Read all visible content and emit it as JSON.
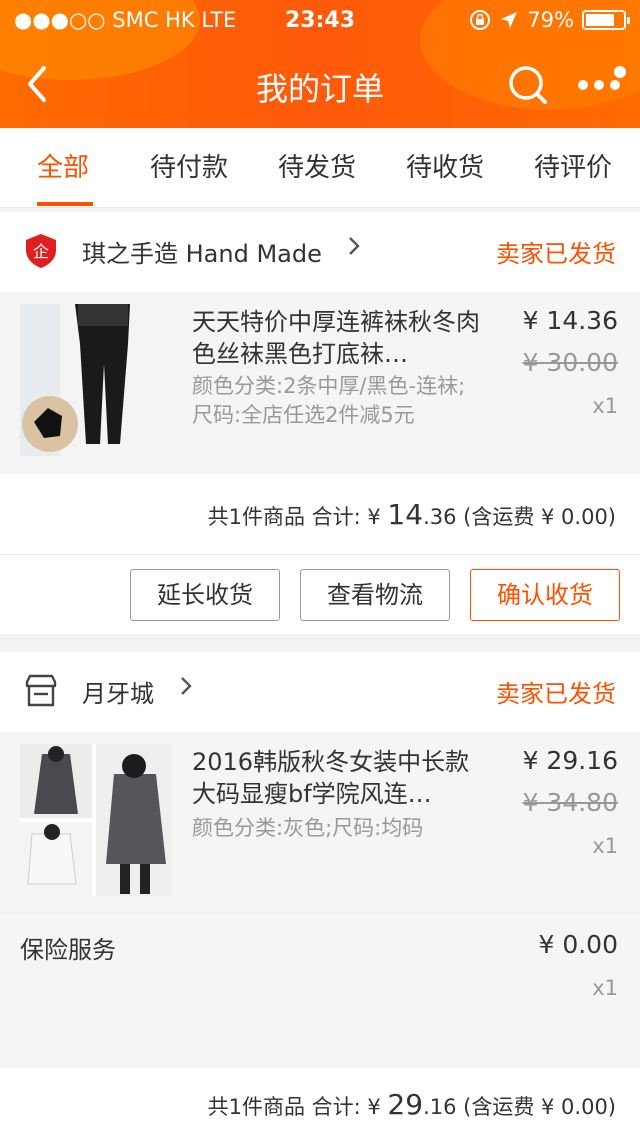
{
  "status_bar": {
    "carrier": "●●●○○ SMC HK  LTE",
    "time": "23:43",
    "battery": "79%",
    "battery_level": 0.79
  },
  "header": {
    "back_glyph": "〈",
    "title": "我的订单"
  },
  "tabs": [
    {
      "label": "全部",
      "active": true
    },
    {
      "label": "待付款"
    },
    {
      "label": "待发货"
    },
    {
      "label": "待收货"
    },
    {
      "label": "待评价"
    }
  ],
  "orders": [
    {
      "shop_name": "琪之手造 Hand Made",
      "shop_badge": "企",
      "status": "卖家已发货",
      "item": {
        "title": "天天特价中厚连裤袜秋冬肉色丝袜黑色打底袜…",
        "spec": "颜色分类:2条中厚/黑色-连袜;尺码:全店任选2件减5元",
        "price": "¥ 14.36",
        "old_price": "¥ 30.00",
        "qty": "x1"
      },
      "summary": {
        "prefix": "共1件商品  合计: ¥ ",
        "amount_big": "14",
        "amount_small": ".36",
        "suffix": " (含运费 ¥ 0.00)"
      },
      "actions": [
        "延长收货",
        "查看物流",
        "确认收货"
      ]
    },
    {
      "shop_name": "月牙城",
      "status": "卖家已发货",
      "item": {
        "title": "2016韩版秋冬女装中长款大码显瘦bf学院风连…",
        "spec": "颜色分类:灰色;尺码:均码",
        "price": "¥ 29.16",
        "old_price": "¥ 34.80",
        "qty": "x1"
      },
      "insurance": {
        "label": "保险服务",
        "price": "¥ 0.00",
        "qty": "x1"
      },
      "summary": {
        "prefix": "共1件商品  合计: ¥ ",
        "amount_big": "29",
        "amount_small": ".16",
        "suffix": " (含运费 ¥ 0.00)"
      }
    }
  ],
  "colors": {
    "brand": "#ff5000",
    "header_bg": "#ff6a00"
  }
}
